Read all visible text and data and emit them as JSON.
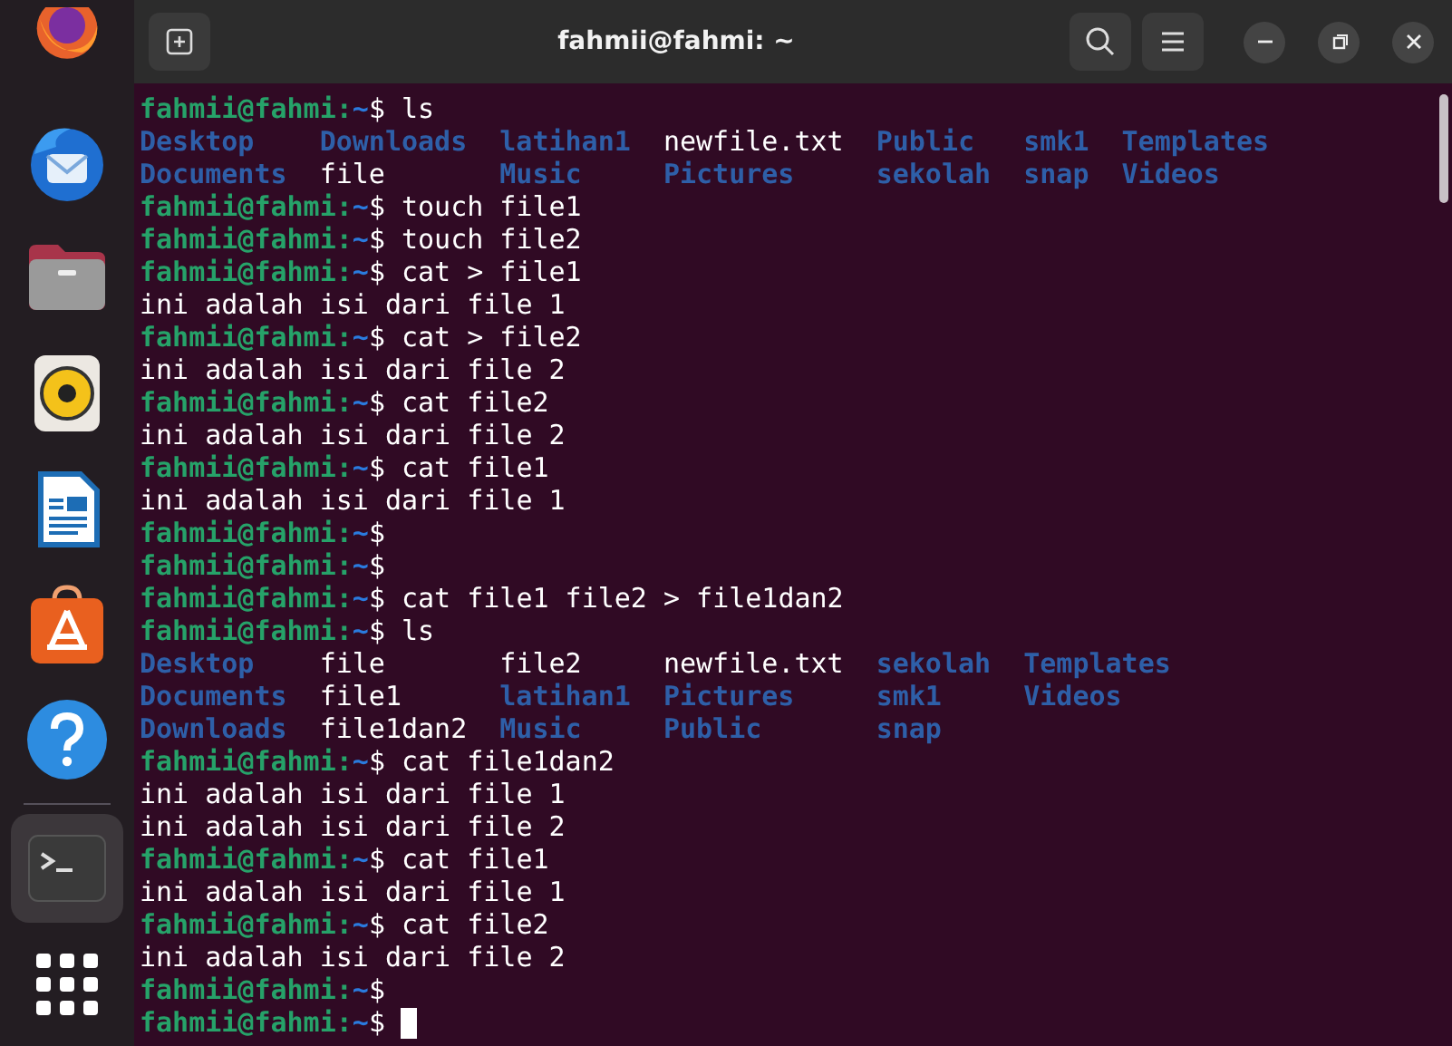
{
  "window": {
    "title": "fahmii@fahmi: ~"
  },
  "dock": {
    "items": [
      {
        "kind": "firefox",
        "selected": false
      },
      {
        "kind": "thunderbird",
        "selected": false
      },
      {
        "kind": "files",
        "selected": false
      },
      {
        "kind": "rhythmbox",
        "selected": false
      },
      {
        "kind": "writer",
        "selected": false
      },
      {
        "kind": "appcenter",
        "selected": false
      },
      {
        "kind": "help",
        "selected": false
      },
      {
        "kind": "separator"
      },
      {
        "kind": "terminal",
        "selected": true
      },
      {
        "kind": "apps",
        "selected": false
      }
    ]
  },
  "terminal": {
    "lines": [
      {
        "kind": "prompt",
        "user_host": "fahmii@fahmi:",
        "path": "~",
        "symbol": "$",
        "command": "ls"
      },
      {
        "kind": "listing",
        "rows": [
          [
            {
              "name": "Desktop",
              "kind": "dir"
            },
            {
              "name": "Downloads",
              "kind": "dir"
            },
            {
              "name": "latihan1",
              "kind": "dir"
            },
            {
              "name": "newfile.txt",
              "kind": "file"
            },
            {
              "name": "Public",
              "kind": "dir"
            },
            {
              "name": "smk1",
              "kind": "dir"
            },
            {
              "name": "Templates",
              "kind": "dir"
            }
          ],
          [
            {
              "name": "Documents",
              "kind": "dir"
            },
            {
              "name": "file",
              "kind": "file"
            },
            {
              "name": "Music",
              "kind": "dir"
            },
            {
              "name": "Pictures",
              "kind": "dir"
            },
            {
              "name": "sekolah",
              "kind": "dir"
            },
            {
              "name": "snap",
              "kind": "dir"
            },
            {
              "name": "Videos",
              "kind": "dir"
            }
          ]
        ]
      },
      {
        "kind": "prompt",
        "user_host": "fahmii@fahmi:",
        "path": "~",
        "symbol": "$",
        "command": "touch file1"
      },
      {
        "kind": "prompt",
        "user_host": "fahmii@fahmi:",
        "path": "~",
        "symbol": "$",
        "command": "touch file2"
      },
      {
        "kind": "prompt",
        "user_host": "fahmii@fahmi:",
        "path": "~",
        "symbol": "$",
        "command": "cat > file1"
      },
      {
        "kind": "output",
        "text": "ini adalah isi dari file 1"
      },
      {
        "kind": "prompt",
        "user_host": "fahmii@fahmi:",
        "path": "~",
        "symbol": "$",
        "command": "cat > file2"
      },
      {
        "kind": "output",
        "text": "ini adalah isi dari file 2"
      },
      {
        "kind": "prompt",
        "user_host": "fahmii@fahmi:",
        "path": "~",
        "symbol": "$",
        "command": "cat file2"
      },
      {
        "kind": "output",
        "text": "ini adalah isi dari file 2"
      },
      {
        "kind": "prompt",
        "user_host": "fahmii@fahmi:",
        "path": "~",
        "symbol": "$",
        "command": "cat file1"
      },
      {
        "kind": "output",
        "text": "ini adalah isi dari file 1"
      },
      {
        "kind": "prompt",
        "user_host": "fahmii@fahmi:",
        "path": "~",
        "symbol": "$"
      },
      {
        "kind": "prompt",
        "user_host": "fahmii@fahmi:",
        "path": "~",
        "symbol": "$"
      },
      {
        "kind": "prompt",
        "user_host": "fahmii@fahmi:",
        "path": "~",
        "symbol": "$",
        "command": "cat file1 file2 > file1dan2"
      },
      {
        "kind": "prompt",
        "user_host": "fahmii@fahmi:",
        "path": "~",
        "symbol": "$",
        "command": "ls"
      },
      {
        "kind": "listing",
        "rows": [
          [
            {
              "name": "Desktop",
              "kind": "dir"
            },
            {
              "name": "file",
              "kind": "file"
            },
            {
              "name": "file2",
              "kind": "file"
            },
            {
              "name": "newfile.txt",
              "kind": "file"
            },
            {
              "name": "sekolah",
              "kind": "dir"
            },
            {
              "name": "Templates",
              "kind": "dir"
            }
          ],
          [
            {
              "name": "Documents",
              "kind": "dir"
            },
            {
              "name": "file1",
              "kind": "file"
            },
            {
              "name": "latihan1",
              "kind": "dir"
            },
            {
              "name": "Pictures",
              "kind": "dir"
            },
            {
              "name": "smk1",
              "kind": "dir"
            },
            {
              "name": "Videos",
              "kind": "dir"
            }
          ],
          [
            {
              "name": "Downloads",
              "kind": "dir"
            },
            {
              "name": "file1dan2",
              "kind": "file"
            },
            {
              "name": "Music",
              "kind": "dir"
            },
            {
              "name": "Public",
              "kind": "dir"
            },
            {
              "name": "snap",
              "kind": "dir"
            }
          ]
        ]
      },
      {
        "kind": "prompt",
        "user_host": "fahmii@fahmi:",
        "path": "~",
        "symbol": "$",
        "command": "cat file1dan2"
      },
      {
        "kind": "output",
        "text": "ini adalah isi dari file 1"
      },
      {
        "kind": "output",
        "text": "ini adalah isi dari file 2"
      },
      {
        "kind": "prompt",
        "user_host": "fahmii@fahmi:",
        "path": "~",
        "symbol": "$",
        "command": "cat file1"
      },
      {
        "kind": "output",
        "text": "ini adalah isi dari file 1"
      },
      {
        "kind": "prompt",
        "user_host": "fahmii@fahmi:",
        "path": "~",
        "symbol": "$",
        "command": "cat file2"
      },
      {
        "kind": "output",
        "text": "ini adalah isi dari file 2"
      },
      {
        "kind": "prompt",
        "user_host": "fahmii@fahmi:",
        "path": "~",
        "symbol": "$"
      },
      {
        "kind": "prompt",
        "user_host": "fahmii@fahmi:",
        "path": "~",
        "symbol": "$",
        "cursor": true
      }
    ]
  }
}
